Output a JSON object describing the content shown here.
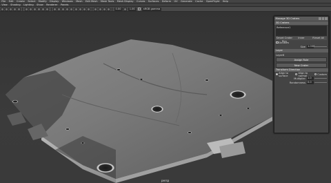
{
  "menubar": [
    "File",
    "Edit",
    "Create",
    "Select",
    "Modify",
    "Display",
    "Windows",
    "Mesh",
    "Edit Mesh",
    "Mesh Tools",
    "Mesh Display",
    "Curves",
    "Surfaces",
    "Deform",
    "UV",
    "Generate",
    "Cache",
    "OpenFlight",
    "Help"
  ],
  "panel_menu": [
    "View",
    "Shading",
    "Lighting",
    "Show",
    "Renderer",
    "Panels"
  ],
  "toolbar": {
    "field1": "0.00",
    "field2": "1.00",
    "colorspace": "sRGB gamma"
  },
  "camera_label": "persp",
  "dialog": {
    "title": "Manage 3D Craters",
    "section_craters": "3D Craters",
    "list_items": [
      "Reference1"
    ],
    "section_options": "Rinset Crater Rim",
    "col_headers": [
      "Smart Crater Rim",
      "Inner",
      "Rinset All"
    ],
    "doubles_label": "Doubles",
    "size_label": "Size",
    "size_value": "1.000",
    "section_layer": "Layer",
    "layer_value": "Layer6",
    "assign_button": "Assign Rule",
    "new_crater_button": "New Crater",
    "section_transform": "Transform Direction",
    "radio_labels": [
      "Align to surface",
      "Align to normal",
      "Custom"
    ],
    "multiplier_label": "Multiplier",
    "multiplier_value": "1.0",
    "randomness_label": "Randomness",
    "randomness_value": "0.0"
  }
}
